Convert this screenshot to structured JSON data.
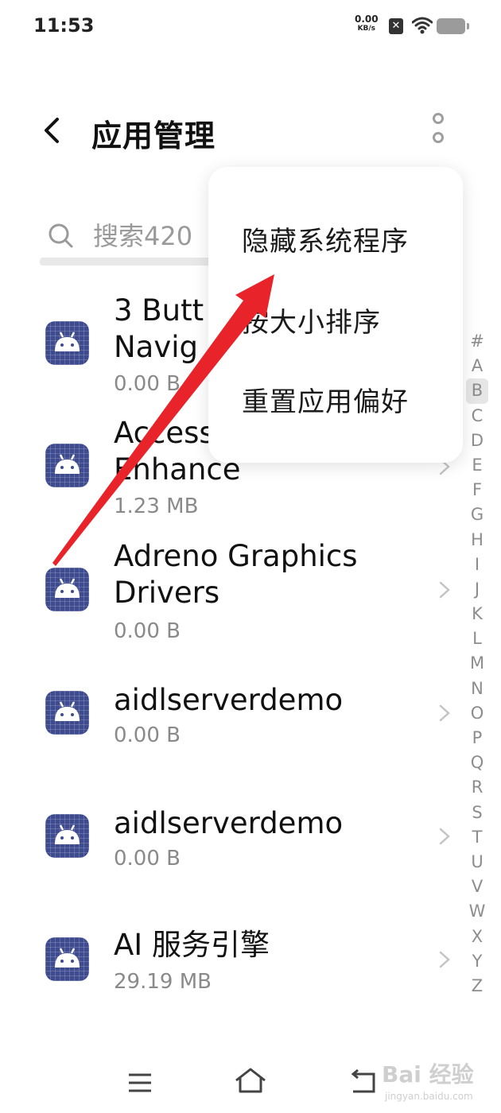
{
  "status_bar": {
    "time": "11:53",
    "net_speed_value": "0.00",
    "net_speed_unit": "KB/s",
    "sim_label": "✕"
  },
  "header": {
    "title": "应用管理",
    "back_icon": "chevron-left-icon",
    "more_icon": "vertical-dots-icon"
  },
  "search": {
    "placeholder": "搜索420"
  },
  "apps": [
    {
      "name_line1": "3 Butt",
      "name_line2": "Navig",
      "size": "0.00 B"
    },
    {
      "name_line1": "Access",
      "name_line2": "Enhance",
      "size": "1.23 MB"
    },
    {
      "name_line1": "Adreno Graphics",
      "name_line2": "Drivers",
      "size": "0.00 B"
    },
    {
      "name_line1": "aidlserverdemo",
      "size": "0.00 B"
    },
    {
      "name_line1": "aidlserverdemo",
      "size": "0.00 B"
    },
    {
      "name_line1": "AI 服务引擎",
      "size": "29.19 MB"
    }
  ],
  "index_letters": [
    "#",
    "A",
    "B",
    "C",
    "D",
    "E",
    "F",
    "G",
    "H",
    "I",
    "J",
    "K",
    "L",
    "M",
    "N",
    "O",
    "P",
    "Q",
    "R",
    "S",
    "T",
    "U",
    "V",
    "W",
    "X",
    "Y",
    "Z"
  ],
  "index_selected": "B",
  "popup_menu": {
    "items": [
      "隐藏系统程序",
      "按大小排序",
      "重置应用偏好"
    ]
  },
  "annotation": {
    "arrow_color": "#e8232a"
  },
  "watermark": {
    "text": "Bai 经验",
    "sub": "jingyan.baidu.com"
  }
}
